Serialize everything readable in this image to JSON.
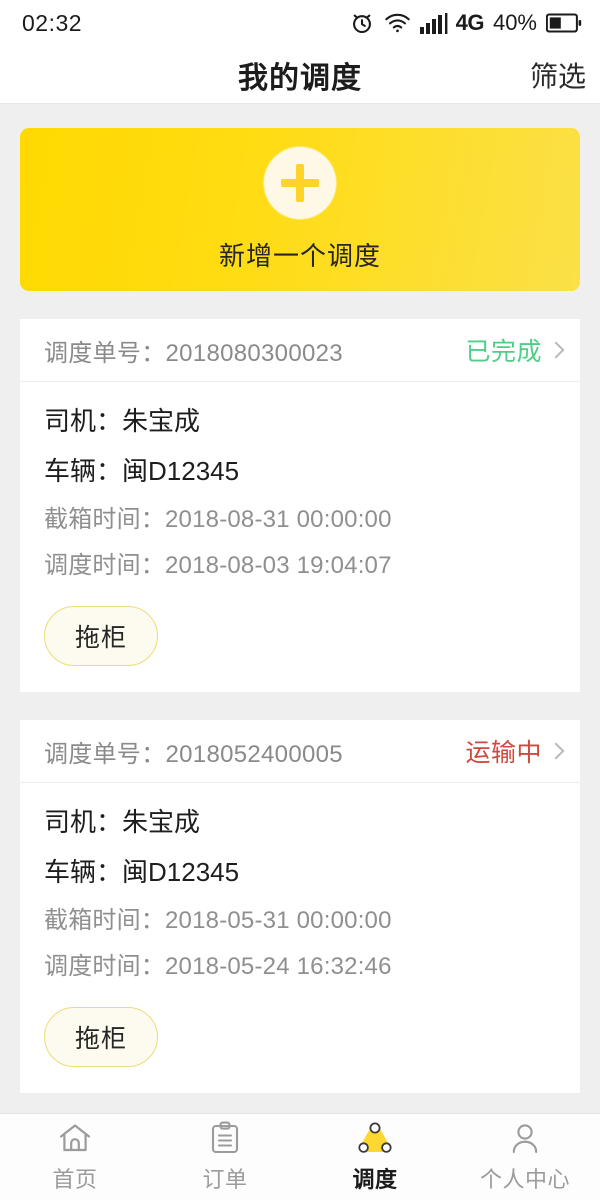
{
  "statusbar": {
    "time": "02:32",
    "network": "4G",
    "battery_pct": "40%",
    "icons": [
      "alarm-clock-icon",
      "wifi-icon",
      "cellular-signal-icon",
      "battery-icon"
    ]
  },
  "header": {
    "title": "我的调度",
    "action_label": "筛选"
  },
  "add_card": {
    "label": "新增一个调度",
    "icon": "plus-icon",
    "gradient_from": "#FFD900",
    "gradient_to": "#FBE047"
  },
  "labels": {
    "order_no": "调度单号：",
    "driver": "司机：",
    "vehicle": "车辆：",
    "cutoff_time": "截箱时间：",
    "dispatch_time": "调度时间："
  },
  "colors": {
    "accent": "#FFD900",
    "status_done": "#4FCF86",
    "status_transit": "#D0493F",
    "page_bg": "#EFEFEF"
  },
  "cards": [
    {
      "order_no": "调度单号：2018080300023",
      "status": "已完成",
      "status_type": "done",
      "driver": "司机：朱宝成",
      "vehicle": "车辆：闽D12345",
      "cutoff_time": "截箱时间：2018-08-31 00:00:00",
      "dispatch_time": "调度时间：2018-08-03 19:04:07",
      "tag": "拖柜"
    },
    {
      "order_no": "调度单号：2018052400005",
      "status": "运输中",
      "status_type": "transit",
      "driver": "司机：朱宝成",
      "vehicle": "车辆：闽D12345",
      "cutoff_time": "截箱时间：2018-05-31 00:00:00",
      "dispatch_time": "调度时间：2018-05-24 16:32:46",
      "tag": "拖柜"
    }
  ],
  "tabbar": {
    "active_index": 2,
    "items": [
      {
        "label": "首页",
        "icon": "home-icon"
      },
      {
        "label": "订单",
        "icon": "clipboard-icon"
      },
      {
        "label": "调度",
        "icon": "dispatch-network-icon"
      },
      {
        "label": "个人中心",
        "icon": "user-icon"
      }
    ]
  }
}
